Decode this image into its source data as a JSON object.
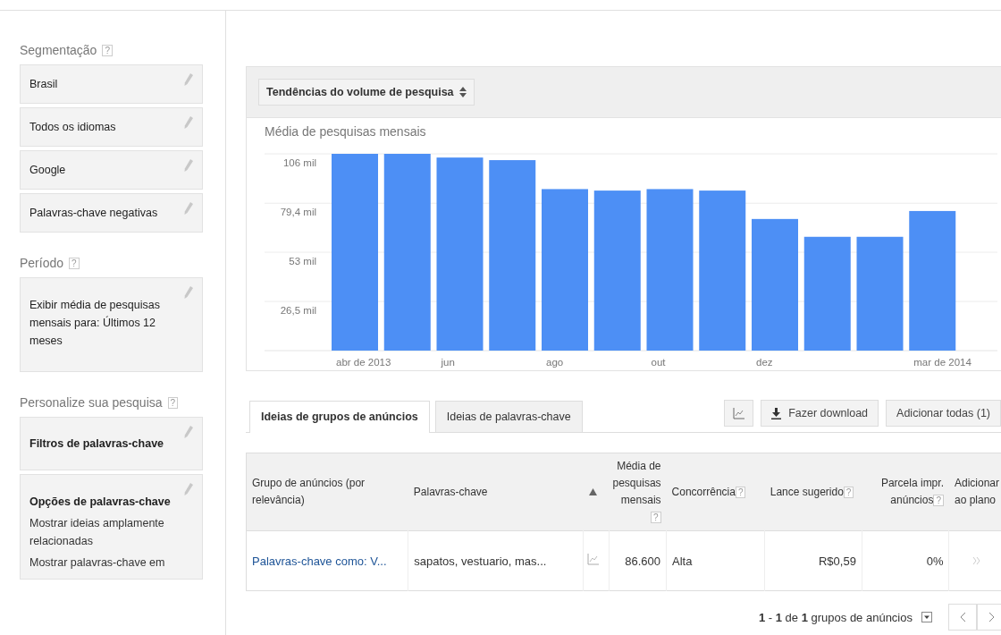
{
  "sidebar": {
    "sections": [
      {
        "title": "Segmentação",
        "help": "?",
        "cards": [
          {
            "kind": "plain",
            "text": "Brasil"
          },
          {
            "kind": "plain",
            "text": "Todos os idiomas"
          },
          {
            "kind": "plain",
            "text": "Google"
          },
          {
            "kind": "plain",
            "text": "Palavras-chave negativas"
          }
        ]
      },
      {
        "title": "Período",
        "help": "?",
        "cards": [
          {
            "kind": "tall",
            "text": "Exibir média de pesquisas mensais para: Últimos 12 meses"
          }
        ]
      },
      {
        "title": "Personalize sua pesquisa",
        "help": "?",
        "cards": [
          {
            "kind": "heading",
            "text": "Filtros de palavras-chave"
          },
          {
            "kind": "options",
            "text": "Opções de palavras-chave",
            "lines": [
              "Mostrar ideias amplamente relacionadas",
              "Mostrar palavras-chave em"
            ]
          }
        ]
      }
    ]
  },
  "chart_panel": {
    "selector": "Tendências do volume de pesquisa",
    "chart_data": {
      "type": "bar",
      "title": "Média de pesquisas mensais",
      "categories": [
        "abr de 2013",
        null,
        "jun",
        null,
        "ago",
        null,
        "out",
        null,
        "dez",
        null,
        null,
        "mar de 2014"
      ],
      "series": [
        {
          "color": "#4d8ff5",
          "values": [
            106,
            106,
            104,
            102.6,
            87,
            86.2,
            87,
            86.2,
            70.9,
            61.3,
            61.3,
            75.2
          ]
        }
      ],
      "grid": true,
      "ylim": [
        0,
        106
      ],
      "yticks": [
        {
          "value": 26.5,
          "label": "26,5 mil"
        },
        {
          "value": 53,
          "label": "53 mil"
        },
        {
          "value": 79.4,
          "label": "79,4 mil"
        },
        {
          "value": 106,
          "label": "106 mil"
        }
      ]
    }
  },
  "tabs": [
    {
      "label": "Ideias de grupos de anúncios",
      "selected": true
    },
    {
      "label": "Ideias de palavras-chave",
      "selected": false
    }
  ],
  "toolbar": {
    "download": "Fazer download",
    "add_all": "Adicionar todas (1)"
  },
  "table": {
    "columns": [
      {
        "label": "Grupo de anúncios (por relevância)",
        "sorted": false
      },
      {
        "label": "Palavras-chave",
        "sorted": false
      },
      {
        "label": "Média de pesquisas mensais",
        "help": "?",
        "sorted": true
      },
      {
        "label": "Concorrência",
        "help": "?",
        "sorted": false
      },
      {
        "label": "Lance sugerido",
        "help": "?",
        "sorted": false
      },
      {
        "label": "Parcela impr. anúncios",
        "help": "?",
        "sorted": false
      },
      {
        "label": "Adicionar ao plano",
        "sorted": false
      }
    ],
    "rows": [
      {
        "group": "Palavras-chave como: V...",
        "keywords": "sapatos, vestuario, mas...",
        "searches": "86.600",
        "competition": "Alta",
        "bid": "R$0,59",
        "share": "0%"
      }
    ]
  },
  "pagination": {
    "text": "**1** - **1** de **1** grupos de anúncios"
  }
}
